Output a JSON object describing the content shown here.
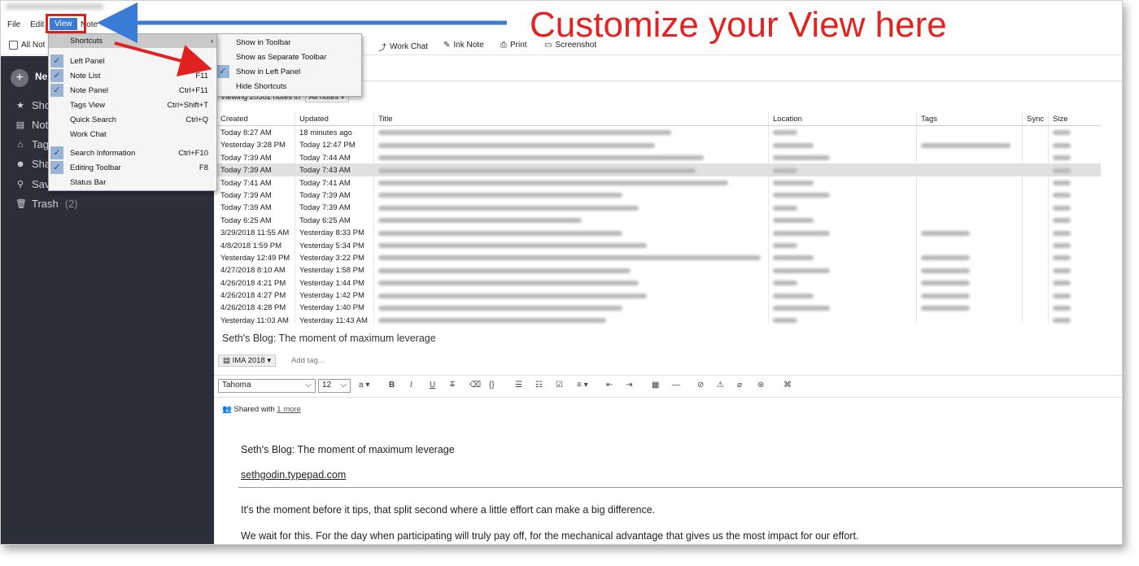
{
  "menubar": {
    "file": "File",
    "edit": "Edit",
    "view": "View",
    "note": "Note"
  },
  "toolbar": {
    "all_notes": "All Not",
    "work_chat": "Work Chat",
    "ink_note": "Ink Note",
    "print": "Print",
    "screenshot": "Screenshot"
  },
  "callout": "Customize your View here",
  "view_menu": {
    "items": [
      {
        "label": "Shortcuts",
        "shortcut": "",
        "checked": false,
        "highlighted": true
      },
      {
        "label": "Left Panel",
        "shortcut": "",
        "checked": true
      },
      {
        "label": "Note List",
        "shortcut": "F11",
        "checked": true
      },
      {
        "label": "Note Panel",
        "shortcut": "Ctrl+F11",
        "checked": true
      },
      {
        "label": "Tags View",
        "shortcut": "Ctrl+Shift+T",
        "checked": false
      },
      {
        "label": "Quick Search",
        "shortcut": "Ctrl+Q",
        "checked": false
      },
      {
        "label": "Work Chat",
        "shortcut": "",
        "checked": false
      },
      {
        "label": "Search Information",
        "shortcut": "Ctrl+F10",
        "checked": true
      },
      {
        "label": "Editing Toolbar",
        "shortcut": "F8",
        "checked": true
      },
      {
        "label": "Status Bar",
        "shortcut": "",
        "checked": false
      }
    ]
  },
  "shortcuts_menu": {
    "items": [
      {
        "label": "Show in Toolbar",
        "checked": false
      },
      {
        "label": "Show as Separate Toolbar",
        "checked": false
      },
      {
        "label": "Show in Left Panel",
        "checked": true
      },
      {
        "label": "Hide Shortcuts",
        "checked": false
      }
    ]
  },
  "sidebar": {
    "new_label": "Ne",
    "items": [
      {
        "label": "Sho",
        "icon": "star-icon"
      },
      {
        "label": "Not",
        "icon": "note-icon"
      },
      {
        "label": "Tags",
        "icon": "tag-icon"
      },
      {
        "label": "Sha",
        "icon": "share-icon"
      },
      {
        "label": "Sav",
        "icon": "search-icon"
      },
      {
        "label": "Trash",
        "count": "(2)",
        "icon": "trash-icon"
      }
    ]
  },
  "list": {
    "viewing": "Viewing 20502 notes in",
    "scope": "All notes",
    "columns": {
      "created": "Created",
      "updated": "Updated",
      "title": "Title",
      "location": "Location",
      "tags": "Tags",
      "sync": "Sync",
      "size": "Size"
    },
    "rows": [
      {
        "created": "Today 8:27 AM",
        "updated": "18 minutes ago"
      },
      {
        "created": "Yesterday 3:28 PM",
        "updated": "Today 12:47 PM"
      },
      {
        "created": "Today 7:39 AM",
        "updated": "Today 7:44 AM"
      },
      {
        "created": "Today 7:39 AM",
        "updated": "Today 7:43 AM",
        "selected": true
      },
      {
        "created": "Today 7:41 AM",
        "updated": "Today 7:41 AM"
      },
      {
        "created": "Today 7:39 AM",
        "updated": "Today 7:39 AM"
      },
      {
        "created": "Today 7:39 AM",
        "updated": "Today 7:39 AM"
      },
      {
        "created": "Today 6:25 AM",
        "updated": "Today 6:25 AM"
      },
      {
        "created": "3/29/2018 11:55 AM",
        "updated": "Yesterday 8:33 PM"
      },
      {
        "created": "4/8/2018 1:59 PM",
        "updated": "Yesterday 5:34 PM"
      },
      {
        "created": "Yesterday 12:49 PM",
        "updated": "Yesterday 3:22 PM"
      },
      {
        "created": "4/27/2018 8:10 AM",
        "updated": "Yesterday 1:58 PM"
      },
      {
        "created": "4/26/2018 4:21 PM",
        "updated": "Yesterday 1:44 PM"
      },
      {
        "created": "4/26/2018 4:27 PM",
        "updated": "Yesterday 1:42 PM"
      },
      {
        "created": "4/26/2018 4:28 PM",
        "updated": "Yesterday 1:40 PM"
      },
      {
        "created": "Yesterday 11:03 AM",
        "updated": "Yesterday 11:43 AM"
      }
    ]
  },
  "note": {
    "title": "Seth's Blog: The moment of maximum leverage",
    "notebook": "IMA 2018",
    "add_tag": "Add tag...",
    "font": "Tahoma",
    "font_size": "12",
    "shared_with": "Shared with",
    "shared_more": "1 more",
    "body_title": "Seth's Blog: The moment of maximum leverage",
    "body_link": "sethgodin.typepad.com",
    "para1": "It's the moment before it tips, that split second where a little effort can make a big difference.",
    "para2": "We wait for this. For the day when participating will truly pay off, for the mechanical advantage that gives us the most impact for our effort."
  },
  "colors": {
    "callout_red": "#e32222",
    "arrow_blue": "#3a7bd5",
    "sidebar_bg": "#2b2f38"
  }
}
